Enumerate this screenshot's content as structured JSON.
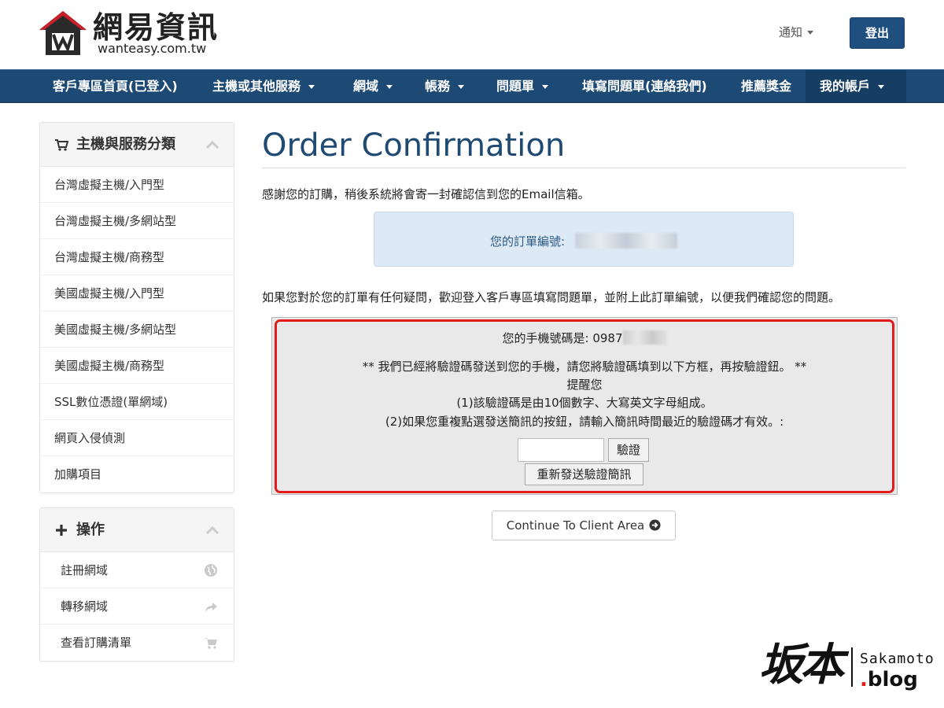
{
  "header": {
    "logo_title": "網易資訊",
    "logo_url": "wanteasy.com.tw",
    "notify_label": "通知",
    "logout_label": "登出"
  },
  "nav": {
    "items": [
      {
        "label": "客戶專區首頁(已登入)",
        "dropdown": false
      },
      {
        "label": "主機或其他服務",
        "dropdown": true
      },
      {
        "label": "網域",
        "dropdown": true
      },
      {
        "label": "帳務",
        "dropdown": true
      },
      {
        "label": "問題單",
        "dropdown": true
      },
      {
        "label": "填寫問題單(連絡我們)",
        "dropdown": false
      },
      {
        "label": "推薦獎金",
        "dropdown": false
      },
      {
        "label": "我的帳戶",
        "dropdown": true
      }
    ]
  },
  "sidebar": {
    "categories": {
      "title": "主機與服務分類",
      "items": [
        "台灣虛擬主機/入門型",
        "台灣虛擬主機/多網站型",
        "台灣虛擬主機/商務型",
        "美國虛擬主機/入門型",
        "美國虛擬主機/多網站型",
        "美國虛擬主機/商務型",
        "SSL數位憑證(單網域)",
        "網頁入侵偵測",
        "加購項目"
      ]
    },
    "actions": {
      "title": "操作",
      "items": [
        {
          "label": "註冊網域",
          "icon": "globe-icon"
        },
        {
          "label": "轉移網域",
          "icon": "share-arrow-icon"
        },
        {
          "label": "查看訂購清單",
          "icon": "cart-icon"
        }
      ]
    }
  },
  "main": {
    "title": "Order Confirmation",
    "thanks": "感謝您的訂購，稍後系統將會寄一封確認信到您的Email信箱。",
    "order_label": "您的訂單編號:",
    "question": "如果您對於您的訂單有任何疑問，歡迎登入客戶專區填寫問題單，並附上此訂單編號，以便我們確認您的問題。",
    "verify": {
      "phone_label": "您的手機號碼是: 0987",
      "notice": "** 我們已經將驗證碼發送到您的手機，請您將驗證碼填到以下方框，再按驗證鈕。 **",
      "remind": "提醒您",
      "rule1": "(1)該驗證碼是由10個數字、大寫英文字母組成。",
      "rule2": "(2)如果您重複點選發送簡訊的按鈕，請輸入簡訊時間最近的驗證碼才有效。:",
      "input_value": "",
      "verify_button": "驗證",
      "resend_button": "重新發送驗證簡訊"
    },
    "continue_button": "Continue To Client Area"
  },
  "watermark": {
    "cjk": "坂本",
    "en": "Sakamoto",
    "blog_dot": ".",
    "blog": "blog"
  },
  "colors": {
    "nav_bg": "#1d4a75",
    "title": "#1f4a73",
    "highlight_red": "#e41b1b",
    "info_box": "#dde9f5"
  }
}
